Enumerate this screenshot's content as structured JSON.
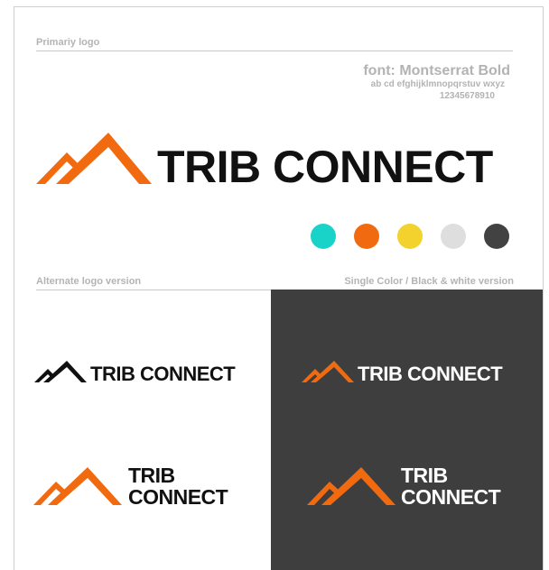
{
  "sheet": {
    "primary_label": "Primariy logo",
    "alternate_label": "Alternate logo version",
    "single_color_label": "Single Color / Black & white version"
  },
  "font_info": {
    "title": "font: Montserrat Bold",
    "sample_letters": "ab cd efghijklmnopqrstuv wxyz",
    "sample_numbers": "12345678910"
  },
  "brand": {
    "name": "TRIB CONNECT",
    "line1": "TRIB",
    "line2": "CONNECT",
    "logo_icon": "mountain-peaks-icon"
  },
  "palette": {
    "turquoise": "#1ad3c8",
    "orange": "#f26a10",
    "yellow": "#f3d22e",
    "light_gray": "#dedede",
    "dark_gray": "#424242"
  }
}
